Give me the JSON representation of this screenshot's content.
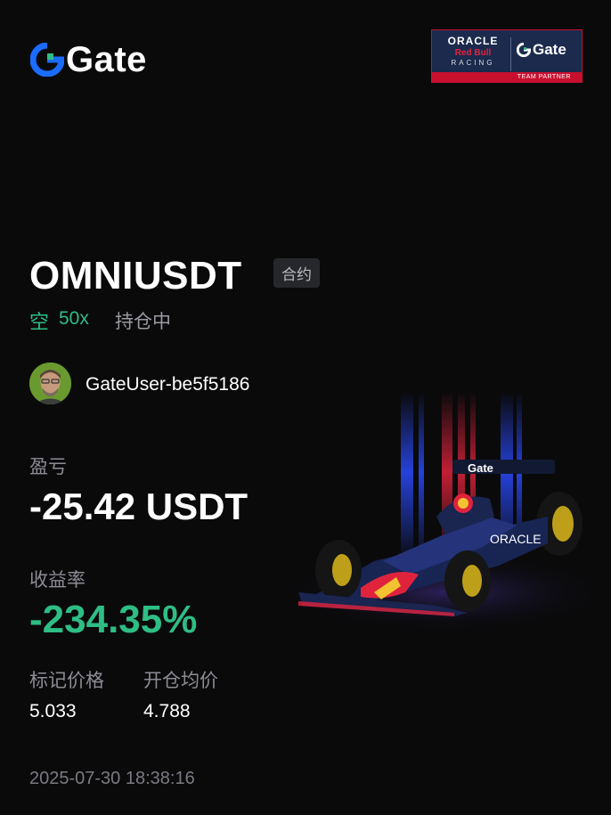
{
  "brand": {
    "name": "Gate",
    "accent": "#1A6CFF",
    "mark_accent": "#2ebd85"
  },
  "partner": {
    "oracle": "ORACLE",
    "red_bull": "Red Bull",
    "racing": "RACING",
    "gate": "Gate",
    "caption": "TEAM PARTNER"
  },
  "position": {
    "symbol": "OMNIUSDT",
    "contract_tag": "合约",
    "side": "空",
    "leverage": "50x",
    "status": "持仓中"
  },
  "user": {
    "name": "GateUser-be5f5186"
  },
  "pnl": {
    "label": "盈亏",
    "value": "-25.42 USDT"
  },
  "roi": {
    "label": "收益率",
    "value": "-234.35%"
  },
  "prices": {
    "mark_label": "标记价格",
    "mark_value": "5.033",
    "entry_label": "开仓均价",
    "entry_value": "4.788"
  },
  "timestamp": "2025-07-30 18:38:16",
  "colors": {
    "short": "#2ebd85",
    "muted": "#8c8c94",
    "background": "#0a0a0b"
  }
}
